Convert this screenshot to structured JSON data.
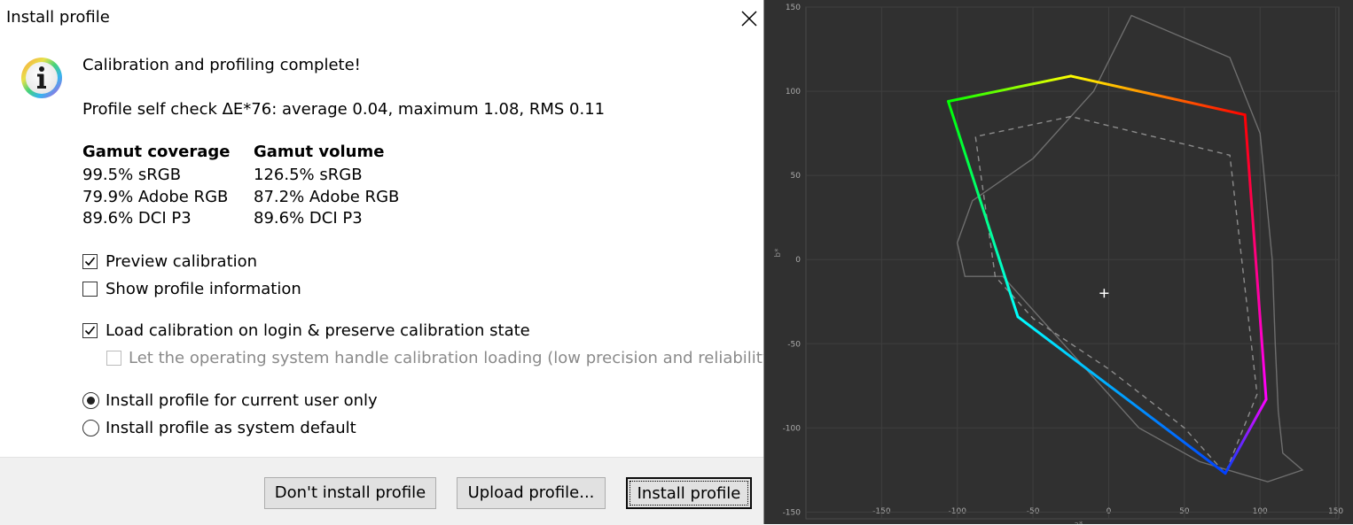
{
  "dialog": {
    "title": "Install profile",
    "heading": "Calibration and profiling complete!",
    "self_check": "Profile self check ΔE*76: average 0.04, maximum 1.08, RMS 0.11",
    "gamut_coverage": {
      "header": "Gamut coverage",
      "rows": [
        "99.5% sRGB",
        "79.9% Adobe RGB",
        "89.6% DCI P3"
      ]
    },
    "gamut_volume": {
      "header": "Gamut volume",
      "rows": [
        "126.5% sRGB",
        "87.2% Adobe RGB",
        "89.6% DCI P3"
      ]
    },
    "options": {
      "preview_calibration": {
        "label": "Preview calibration",
        "checked": true
      },
      "show_profile_info": {
        "label": "Show profile information",
        "checked": false
      },
      "load_calibration": {
        "label": "Load calibration on login & preserve calibration state",
        "checked": true
      },
      "os_handle": {
        "label": "Let the operating system handle calibration loading (low precision and reliability)",
        "checked": false,
        "disabled": true
      },
      "install_current_user": {
        "label": "Install profile for current user only",
        "selected": true
      },
      "install_system_default": {
        "label": "Install profile as system default",
        "selected": false
      }
    },
    "buttons": {
      "dont_install": "Don't install profile",
      "upload": "Upload profile...",
      "install": "Install profile"
    }
  },
  "chart_data": {
    "type": "line",
    "background": "#303030",
    "xlabel": "a*",
    "ylabel": "b*",
    "xlim": [
      -200,
      152
    ],
    "ylim": [
      -154,
      150
    ],
    "x_ticks": [
      -150,
      -100,
      -50,
      0,
      50,
      100,
      150
    ],
    "y_ticks": [
      150,
      100,
      50,
      0,
      -50,
      -100,
      -150
    ],
    "grid": true,
    "white_point": [
      -3,
      -20
    ],
    "series": [
      {
        "style": "visible-locus-outline",
        "color": "#6e6e6e",
        "points": [
          [
            -50,
            60
          ],
          [
            -10,
            100
          ],
          [
            15,
            145
          ],
          [
            80,
            120
          ],
          [
            100,
            75
          ],
          [
            108,
            0
          ],
          [
            110,
            -50
          ],
          [
            112,
            -90
          ],
          [
            115,
            -115
          ],
          [
            128,
            -125
          ],
          [
            105,
            -132
          ],
          [
            60,
            -120
          ],
          [
            20,
            -100
          ],
          [
            -20,
            -60
          ],
          [
            -70,
            -10
          ],
          [
            -95,
            -10
          ],
          [
            -100,
            10
          ],
          [
            -90,
            35
          ],
          [
            -50,
            60
          ]
        ]
      },
      {
        "style": "reference-dashed",
        "color": "#8c8c8c",
        "points": [
          [
            -25,
            85
          ],
          [
            -88,
            73
          ],
          [
            -75,
            -10
          ],
          [
            -50,
            -35
          ],
          [
            0,
            -65
          ],
          [
            50,
            -100
          ],
          [
            77,
            -127
          ],
          [
            98,
            -80
          ],
          [
            80,
            62
          ],
          [
            -25,
            85
          ]
        ]
      },
      {
        "style": "profile-gamut",
        "colors": [
          "#ffff00",
          "#ff0000",
          "#ff00ff",
          "#0040ff",
          "#00ffff",
          "#00ff00"
        ],
        "points": [
          [
            -25,
            109
          ],
          [
            90,
            86
          ],
          [
            104,
            -83
          ],
          [
            77,
            -127
          ],
          [
            -60,
            -34
          ],
          [
            -106,
            94
          ],
          [
            -25,
            109
          ]
        ]
      }
    ]
  }
}
